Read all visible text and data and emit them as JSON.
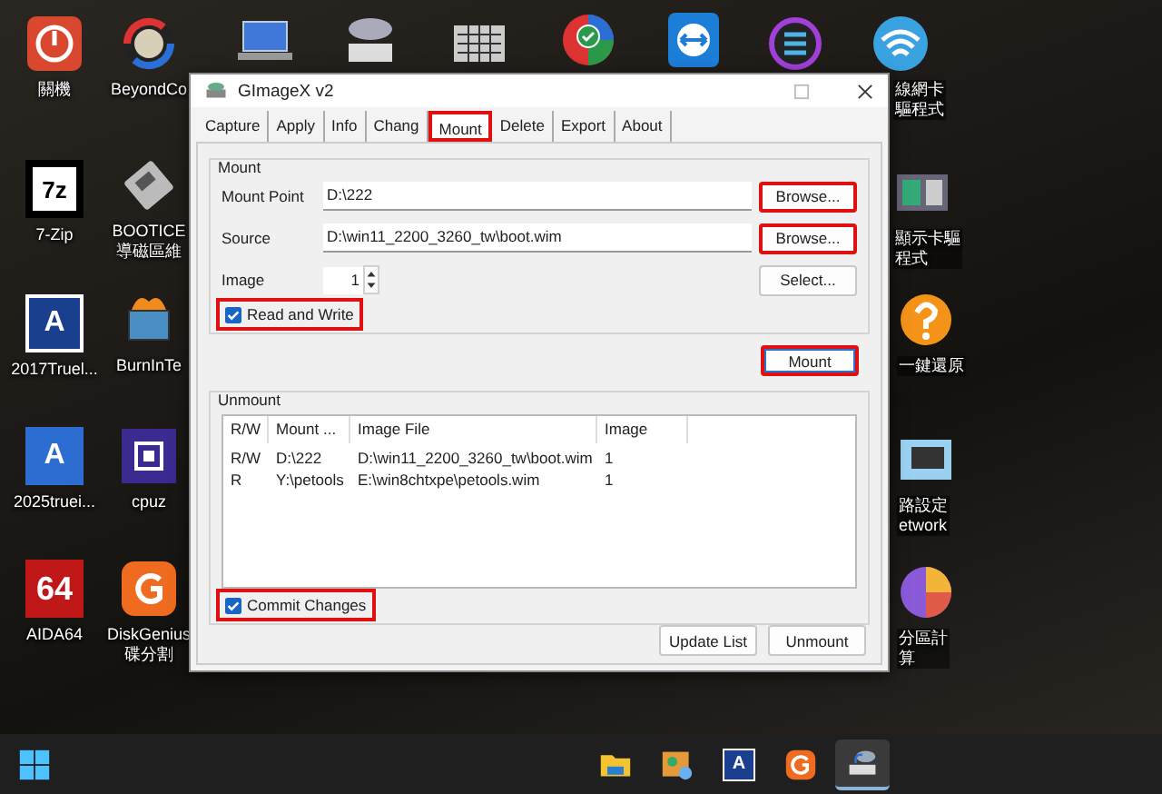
{
  "desktop": {
    "icons": [
      {
        "kind": "power",
        "label": [
          "關機"
        ]
      },
      {
        "kind": "sevenzip",
        "glyph": "7z",
        "label": [
          "7-Zip"
        ]
      },
      {
        "kind": "acronis",
        "glyph": "A",
        "label": [
          "2017Truel..."
        ]
      },
      {
        "kind": "acronis2",
        "glyph": "A",
        "label": [
          "2025truei..."
        ]
      },
      {
        "kind": "aida",
        "glyph": "64",
        "label": [
          "AIDA64"
        ]
      },
      {
        "kind": "beyond",
        "label": [
          "BeyondCo"
        ]
      },
      {
        "kind": "floppy",
        "label": [
          "BOOTICE",
          "導磁區維"
        ]
      },
      {
        "kind": "burnin",
        "label": [
          "BurnInTe"
        ]
      },
      {
        "kind": "cpu",
        "label": [
          "cpuz"
        ]
      },
      {
        "kind": "diskgenius",
        "label": [
          "DiskGenius",
          "碟分割"
        ]
      },
      {
        "kind": "laptop"
      },
      {
        "kind": "drive"
      },
      {
        "kind": "keyboard"
      },
      {
        "kind": "check"
      },
      {
        "kind": "teamviewer"
      },
      {
        "kind": "circle"
      },
      {
        "kind": "wifi",
        "label": [
          "線網卡",
          "驅程式"
        ]
      },
      {
        "kind": "display",
        "label": [
          "顯示卡驅",
          "程式"
        ]
      },
      {
        "kind": "question",
        "label": [
          "一鍵還原"
        ]
      },
      {
        "kind": "network",
        "label": [
          "路設定",
          "etwork"
        ]
      },
      {
        "kind": "pie",
        "label": [
          "分區計",
          "算"
        ]
      }
    ]
  },
  "window": {
    "title": "GImageX v2",
    "tabs": [
      {
        "label": "Capture",
        "selected": false,
        "highlighted": false
      },
      {
        "label": "Apply",
        "selected": false,
        "highlighted": false
      },
      {
        "label": "Info",
        "selected": false,
        "highlighted": false
      },
      {
        "label": "Chang",
        "selected": false,
        "highlighted": false
      },
      {
        "label": "Mount",
        "selected": true,
        "highlighted": true
      },
      {
        "label": "Delete",
        "selected": false,
        "highlighted": false
      },
      {
        "label": "Export",
        "selected": false,
        "highlighted": false
      },
      {
        "label": "About",
        "selected": false,
        "highlighted": false
      }
    ],
    "mount_group": {
      "title": "Mount",
      "fields": [
        {
          "kind": "text",
          "label": "Mount Point",
          "value": "D:\\222",
          "button": "Browse...",
          "highlighted": true
        },
        {
          "kind": "text",
          "label": "Source",
          "value": "D:\\win11_2200_3260_tw\\boot.wim",
          "button": "Browse...",
          "highlighted": true
        },
        {
          "kind": "spin",
          "label": "Image",
          "value": "1",
          "button": "Select...",
          "highlighted": false
        }
      ],
      "read_write": {
        "label": "Read and Write",
        "checked": true,
        "highlighted": true
      }
    },
    "mount_button": {
      "label": "Mount",
      "highlighted": true
    },
    "unmount_group": {
      "title": "Unmount",
      "columns": [
        "R/W",
        "Mount ...",
        "Image File",
        "Image"
      ],
      "rows": [
        [
          "R/W",
          "D:\\222",
          "D:\\win11_2200_3260_tw\\boot.wim",
          "1"
        ],
        [
          "R",
          "Y:\\petools",
          "E:\\win8chtxpe\\petools.wim",
          "1"
        ]
      ],
      "commit": {
        "label": "Commit Changes",
        "checked": true,
        "highlighted": true
      }
    },
    "buttons": [
      "Update List",
      "Unmount"
    ]
  },
  "taskbar": {
    "items": [
      {
        "kind": "start",
        "selected": false
      },
      {
        "kind": "folder",
        "selected": false
      },
      {
        "kind": "paint",
        "selected": false
      },
      {
        "kind": "acronis",
        "glyph": "A",
        "selected": false
      },
      {
        "kind": "diskgenius",
        "selected": false
      },
      {
        "kind": "imagex",
        "selected": true
      }
    ]
  }
}
